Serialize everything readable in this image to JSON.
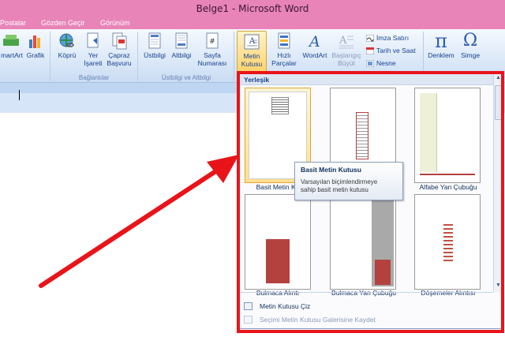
{
  "window": {
    "title": "Belge1 - Microsoft Word"
  },
  "tabs": [
    {
      "label": "Postalar"
    },
    {
      "label": "Gözden Geçir"
    },
    {
      "label": "Görünüm"
    }
  ],
  "ribbon": {
    "illustrations": {
      "smartart": "martArt",
      "chart": "Grafik"
    },
    "links": {
      "hyperlink": "Köprü",
      "bookmark_line1": "Yer",
      "bookmark_line2": "İşareti",
      "crossref_line1": "Çapraz",
      "crossref_line2": "Başvuru",
      "group_label": "Bağlantılar"
    },
    "header_footer": {
      "header": "Üstbilgi",
      "footer": "Altbilgi",
      "pagenum_line1": "Sayfa",
      "pagenum_line2": "Numarası",
      "group_label": "Üstbilgi ve Altbilgi"
    },
    "text": {
      "textbox_line1": "Metin",
      "textbox_line2": "Kutusu",
      "quickparts_line1": "Hızlı",
      "quickparts_line2": "Parçalar",
      "wordart": "WordArt",
      "dropcap_line1": "Başlangıç",
      "dropcap_line2": "Büyüt",
      "signature": "İmza Satırı",
      "datetime": "Tarih ve Saat",
      "object": "Nesne"
    },
    "symbols": {
      "equation": "Denklem",
      "symbol": "Simge",
      "equation_glyph": "π",
      "symbol_glyph": "Ω"
    }
  },
  "gallery": {
    "section_header": "Yerleşik",
    "items": [
      {
        "label": "Basit Metin Ku"
      },
      {
        "label": ""
      },
      {
        "label": "Alfabe Yan Çubuğu"
      },
      {
        "label": "Bulmaca Alıntı"
      },
      {
        "label": "Bulmaca Yan Çubuğu"
      },
      {
        "label": "Döşemeler Alıntısı"
      }
    ],
    "draw_textbox": "Metin Kutusu Çiz",
    "save_selection": "Seçimi Metin Kutusu Galerisine Kaydet"
  },
  "tooltip": {
    "title": "Basit Metin Kutusu",
    "description_line1": "Varsayılan biçimlendirmeye",
    "description_line2": "sahip basit metin kutusu"
  },
  "colors": {
    "title_bar": "#e884b8",
    "highlight_box": "#e8141a",
    "selected_thumb": "#ffdf90",
    "accent_red": "#b3423f"
  }
}
